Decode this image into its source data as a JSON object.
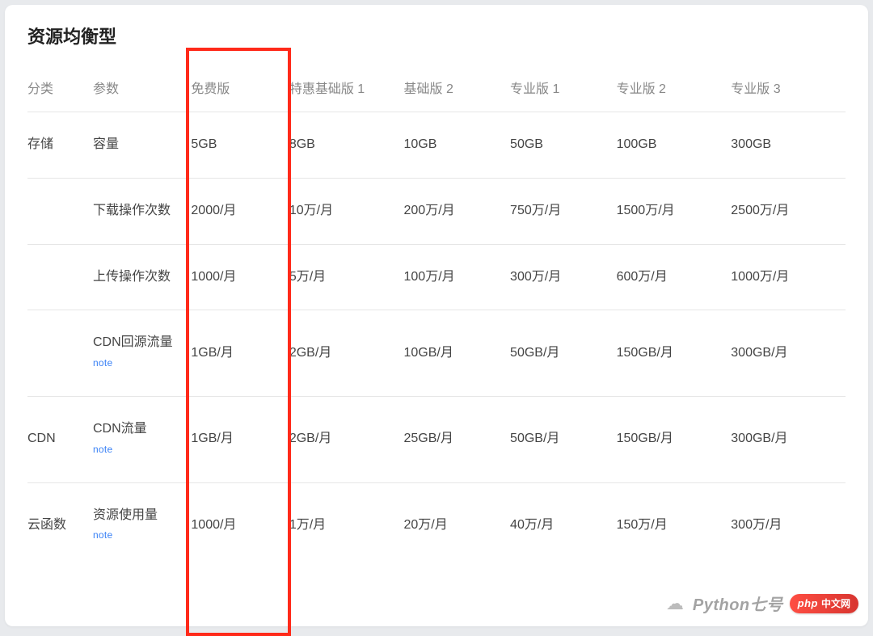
{
  "title": "资源均衡型",
  "headers": [
    "分类",
    "参数",
    "免费版",
    "特惠基础版 1",
    "基础版 2",
    "专业版 1",
    "专业版 2",
    "专业版 3"
  ],
  "note_label": "note",
  "rows": [
    {
      "category": "存储",
      "param": "容量",
      "param_note": false,
      "cells": [
        "5GB",
        "8GB",
        "10GB",
        "50GB",
        "100GB",
        "300GB"
      ]
    },
    {
      "category": "",
      "param": "下载操作次数",
      "param_note": false,
      "cells": [
        "2000/月",
        "10万/月",
        "200万/月",
        "750万/月",
        "1500万/月",
        "2500万/月"
      ]
    },
    {
      "category": "",
      "param": "上传操作次数",
      "param_note": false,
      "cells": [
        "1000/月",
        "5万/月",
        "100万/月",
        "300万/月",
        "600万/月",
        "1000万/月"
      ]
    },
    {
      "category": "",
      "param": "CDN回源流量",
      "param_note": true,
      "cells": [
        "1GB/月",
        "2GB/月",
        "10GB/月",
        "50GB/月",
        "150GB/月",
        "300GB/月"
      ]
    },
    {
      "category": "CDN",
      "param": "CDN流量",
      "param_note": true,
      "cells": [
        "1GB/月",
        "2GB/月",
        "25GB/月",
        "50GB/月",
        "150GB/月",
        "300GB/月"
      ]
    },
    {
      "category": "云函数",
      "param": "资源使用量",
      "param_note": true,
      "cells": [
        "1000/月",
        "1万/月",
        "20万/月",
        "40万/月",
        "150万/月",
        "300万/月"
      ]
    }
  ],
  "watermark": {
    "text1": "Python七号",
    "php_label": "php",
    "php_text": "中文网"
  }
}
